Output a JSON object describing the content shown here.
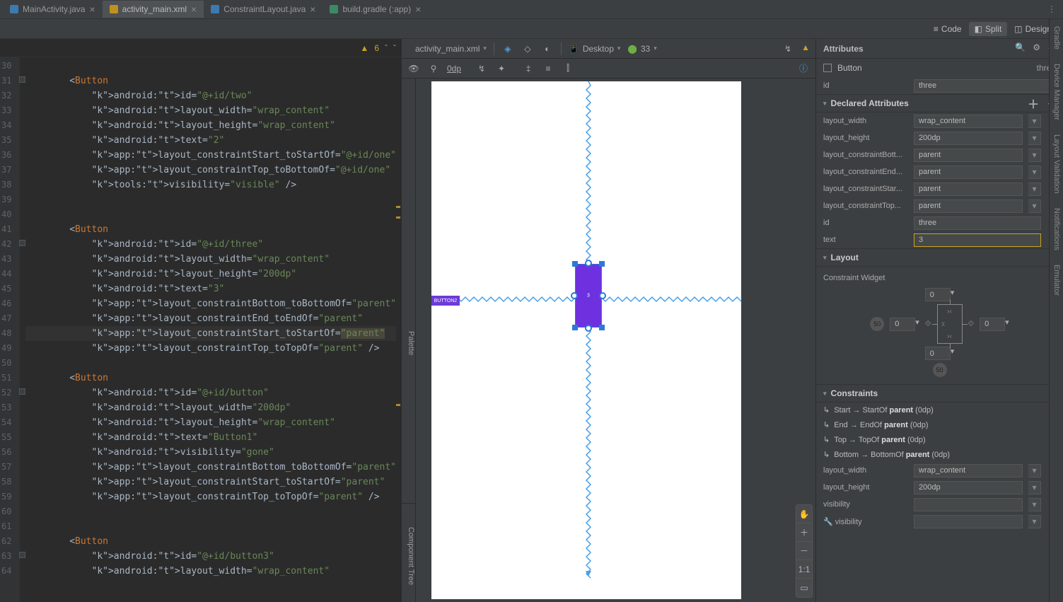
{
  "tabs": [
    {
      "name": "MainActivity.java",
      "active": false,
      "type": "cls"
    },
    {
      "name": "activity_main.xml",
      "active": true,
      "type": "xml"
    },
    {
      "name": "ConstraintLayout.java",
      "active": false,
      "type": "cls"
    },
    {
      "name": "build.gradle (:app)",
      "active": false,
      "type": "gradle"
    }
  ],
  "viewmodes": {
    "code": "Code",
    "split": "Split",
    "design": "Design"
  },
  "editor": {
    "warn_count": "6",
    "line_start": 30,
    "line_end": 65,
    "current_line": 48,
    "lines": [
      "",
      "        <Button",
      "            android:id=\"@+id/two\"",
      "            android:layout_width=\"wrap_content\"",
      "            android:layout_height=\"wrap_content\"",
      "            android:text=\"2\"",
      "            app:layout_constraintStart_toStartOf=\"@+id/one\"",
      "            app:layout_constraintTop_toBottomOf=\"@+id/one\"",
      "            tools:visibility=\"visible\" />",
      "",
      "",
      "        <Button",
      "            android:id=\"@+id/three\"",
      "            android:layout_width=\"wrap_content\"",
      "            android:layout_height=\"200dp\"",
      "            android:text=\"3\"",
      "            app:layout_constraintBottom_toBottomOf=\"parent\"",
      "            app:layout_constraintEnd_toEndOf=\"parent\"",
      "            app:layout_constraintStart_toStartOf=\"parent\"",
      "            app:layout_constraintTop_toTopOf=\"parent\" />",
      "",
      "        <Button",
      "            android:id=\"@+id/button\"",
      "            android:layout_width=\"200dp\"",
      "            android:layout_height=\"wrap_content\"",
      "            android:text=\"Button1\"",
      "            android:visibility=\"gone\"",
      "            app:layout_constraintBottom_toBottomOf=\"parent\"",
      "            app:layout_constraintStart_toStartOf=\"parent\"",
      "            app:layout_constraintTop_toTopOf=\"parent\" />",
      "",
      "",
      "        <Button",
      "            android:id=\"@+id/button3\"",
      "            android:layout_width=\"wrap_content\""
    ],
    "highlights": [
      "android:text=\"2\"",
      "android:text=\"3\"",
      "android:text=\"Button1\"",
      "\"parent\""
    ]
  },
  "design_top": {
    "file": "activity_main.xml",
    "device": "Desktop",
    "api": "33",
    "margin": "0dp"
  },
  "sidev": {
    "palette": "Palette",
    "tree": "Component Tree"
  },
  "preview": {
    "btn2": "BUTTON2",
    "seltext": "3"
  },
  "zoom": {
    "fit": "1:1"
  },
  "attrs": {
    "title": "Attributes",
    "component": "Button",
    "component_name": "three",
    "id_label": "id",
    "id": "three",
    "declared_title": "Declared Attributes",
    "declared": [
      {
        "l": "layout_width",
        "v": "wrap_content",
        "dd": true
      },
      {
        "l": "layout_height",
        "v": "200dp",
        "dd": true
      },
      {
        "l": "layout_constraintBott...",
        "v": "parent",
        "dd": true
      },
      {
        "l": "layout_constraintEnd...",
        "v": "parent",
        "dd": true
      },
      {
        "l": "layout_constraintStar...",
        "v": "parent",
        "dd": true
      },
      {
        "l": "layout_constraintTop...",
        "v": "parent",
        "dd": true
      },
      {
        "l": "id",
        "v": "three",
        "dd": false
      },
      {
        "l": "text",
        "v": "3",
        "dd": false,
        "hi": true
      }
    ],
    "layout_title": "Layout",
    "cwidget_label": "Constraint Widget",
    "margins": {
      "t": "0",
      "b": "0",
      "l": "0",
      "r": "0"
    },
    "bias": {
      "h": "50",
      "v": "50"
    },
    "constraints_title": "Constraints",
    "constraints": [
      {
        "pre": "Start → StartOf ",
        "b": "parent",
        "post": " (0dp)"
      },
      {
        "pre": "End → EndOf ",
        "b": "parent",
        "post": " (0dp)"
      },
      {
        "pre": "Top → TopOf ",
        "b": "parent",
        "post": " (0dp)"
      },
      {
        "pre": "Bottom → BottomOf ",
        "b": "parent",
        "post": " (0dp)"
      }
    ],
    "size": [
      {
        "l": "layout_width",
        "v": "wrap_content",
        "dd": true
      },
      {
        "l": "layout_height",
        "v": "200dp",
        "dd": true
      },
      {
        "l": "visibility",
        "v": "",
        "dd": true
      },
      {
        "l": "visibility",
        "v": "",
        "dd": true,
        "wrench": true
      }
    ]
  },
  "rside": [
    "Gradle",
    "Device Manager",
    "Layout Validation",
    "Notifications",
    "Emulator"
  ]
}
